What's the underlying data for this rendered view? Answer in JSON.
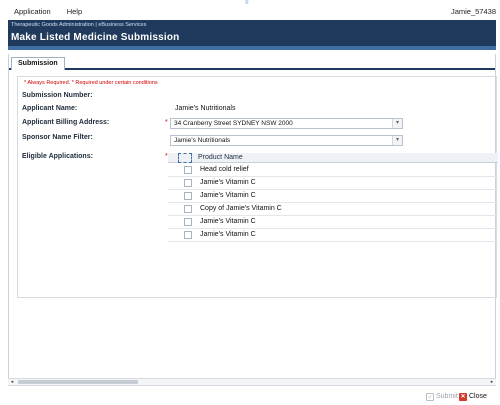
{
  "menubar": {
    "items": [
      "Application",
      "Help"
    ],
    "user": "Jamie_57438"
  },
  "banner": {
    "org": "Therapeutic Goods Administration | eBusiness Services",
    "title": "Make Listed Medicine Submission"
  },
  "tabs": [
    {
      "label": "Submission"
    }
  ],
  "form": {
    "legend_always": "* Always Required.",
    "legend_conditional": "* Required under certain conditions",
    "submission_number_label": "Submission Number:",
    "submission_number_value": "",
    "applicant_name_label": "Applicant Name:",
    "applicant_name_value": "Jamie's Nutritionals",
    "billing_label": "Applicant Billing Address:",
    "billing_value": "34 Cranberry Street SYDNEY NSW 2000",
    "sponsor_label": "Sponsor Name Filter:",
    "sponsor_value": "Jamie's Nutritionals",
    "eligible_label": "Eligible Applications:",
    "required_marker": "*"
  },
  "grid": {
    "header": "Product Name",
    "rows": [
      "Head cold relief",
      "Jamie's Vitamin C",
      "Jamie's Vitamin C",
      "Copy of Jamie's Vitamin C",
      "Jamie's Vitamin C",
      "Jamie's Vitamin C"
    ]
  },
  "footer": {
    "submit_label": "Submit",
    "close_label": "Close",
    "submit_enabled": false
  },
  "icons": {
    "submit": "submit-icon",
    "close": "close-icon",
    "dropdown": "chevron-down-icon"
  },
  "colors": {
    "banner": "#1f3a5c",
    "accent": "#3f6fa2",
    "required": "#cc0000",
    "close": "#d3382a"
  }
}
